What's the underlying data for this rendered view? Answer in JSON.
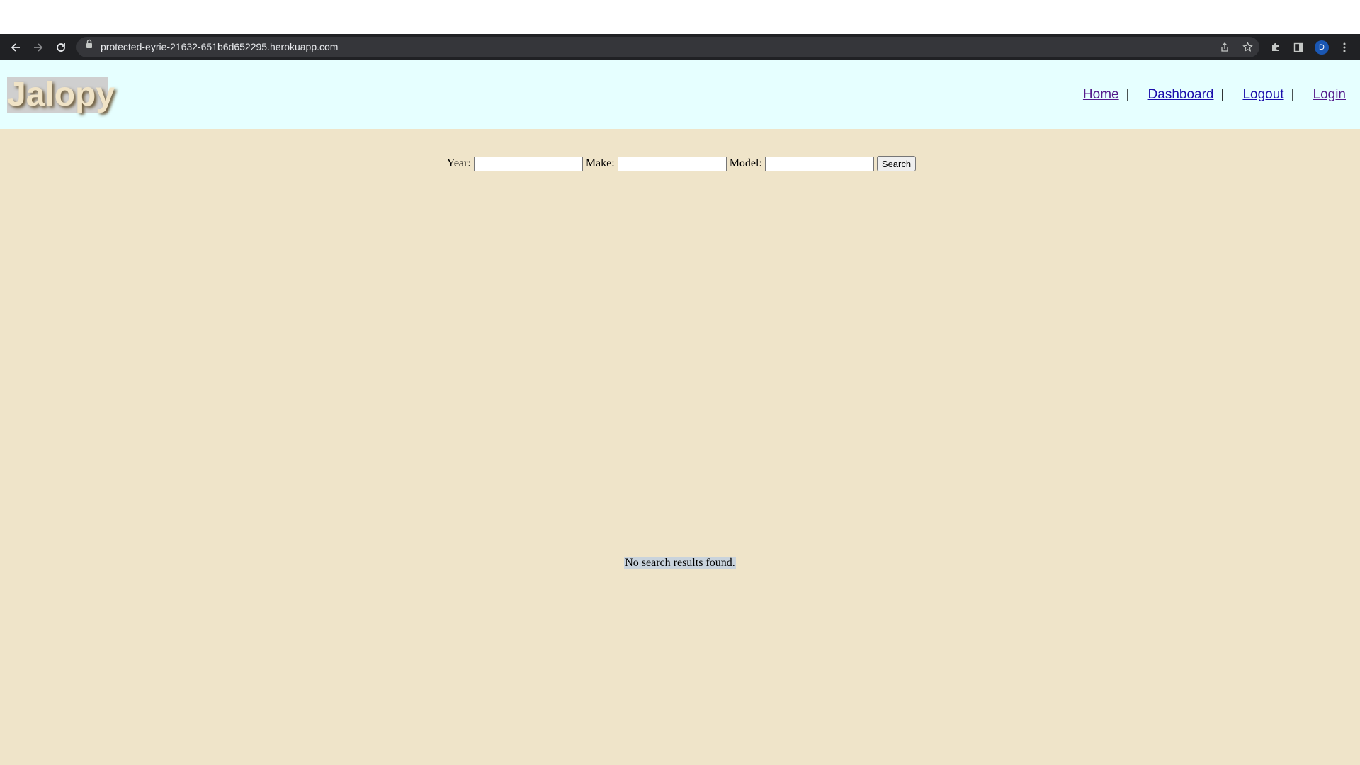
{
  "browser": {
    "url": "protected-eyrie-21632-651b6d652295.herokuapp.com",
    "profile_initial": "D",
    "icons": [
      "back-arrow-icon",
      "forward-arrow-icon",
      "reload-icon",
      "lock-icon",
      "share-icon",
      "bookmark-star-icon",
      "extensions-puzzle-icon",
      "side-panel-icon",
      "kebab-menu-icon"
    ]
  },
  "header": {
    "logo_text": "Jalopy",
    "nav": [
      {
        "label": "Home"
      },
      {
        "label": "Dashboard"
      },
      {
        "label": "Logout"
      },
      {
        "label": "Login"
      }
    ],
    "separator": "|"
  },
  "search": {
    "year_label": "Year:",
    "year_value": "",
    "make_label": "Make:",
    "make_value": "",
    "model_label": "Model:",
    "model_value": "",
    "button_label": "Search"
  },
  "results": {
    "message": "No search results found."
  },
  "colors": {
    "header_bg": "#e6ffff",
    "main_bg": "#efe4c9",
    "link": "#1a0dab",
    "link_visited": "#551a8b"
  }
}
